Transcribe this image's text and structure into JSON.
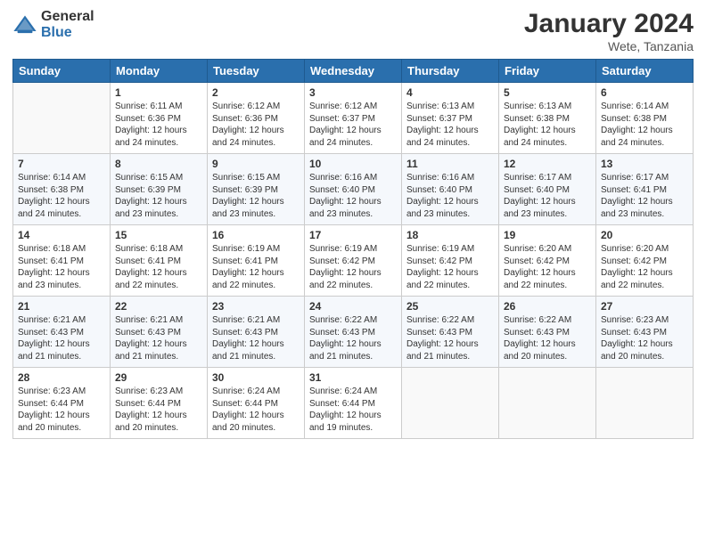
{
  "header": {
    "logo_general": "General",
    "logo_blue": "Blue",
    "month_year": "January 2024",
    "location": "Wete, Tanzania"
  },
  "columns": [
    "Sunday",
    "Monday",
    "Tuesday",
    "Wednesday",
    "Thursday",
    "Friday",
    "Saturday"
  ],
  "weeks": [
    [
      {
        "day": "",
        "sunrise": "",
        "sunset": "",
        "daylight": ""
      },
      {
        "day": "1",
        "sunrise": "Sunrise: 6:11 AM",
        "sunset": "Sunset: 6:36 PM",
        "daylight": "Daylight: 12 hours and 24 minutes."
      },
      {
        "day": "2",
        "sunrise": "Sunrise: 6:12 AM",
        "sunset": "Sunset: 6:36 PM",
        "daylight": "Daylight: 12 hours and 24 minutes."
      },
      {
        "day": "3",
        "sunrise": "Sunrise: 6:12 AM",
        "sunset": "Sunset: 6:37 PM",
        "daylight": "Daylight: 12 hours and 24 minutes."
      },
      {
        "day": "4",
        "sunrise": "Sunrise: 6:13 AM",
        "sunset": "Sunset: 6:37 PM",
        "daylight": "Daylight: 12 hours and 24 minutes."
      },
      {
        "day": "5",
        "sunrise": "Sunrise: 6:13 AM",
        "sunset": "Sunset: 6:38 PM",
        "daylight": "Daylight: 12 hours and 24 minutes."
      },
      {
        "day": "6",
        "sunrise": "Sunrise: 6:14 AM",
        "sunset": "Sunset: 6:38 PM",
        "daylight": "Daylight: 12 hours and 24 minutes."
      }
    ],
    [
      {
        "day": "7",
        "sunrise": "Sunrise: 6:14 AM",
        "sunset": "Sunset: 6:38 PM",
        "daylight": "Daylight: 12 hours and 24 minutes."
      },
      {
        "day": "8",
        "sunrise": "Sunrise: 6:15 AM",
        "sunset": "Sunset: 6:39 PM",
        "daylight": "Daylight: 12 hours and 23 minutes."
      },
      {
        "day": "9",
        "sunrise": "Sunrise: 6:15 AM",
        "sunset": "Sunset: 6:39 PM",
        "daylight": "Daylight: 12 hours and 23 minutes."
      },
      {
        "day": "10",
        "sunrise": "Sunrise: 6:16 AM",
        "sunset": "Sunset: 6:40 PM",
        "daylight": "Daylight: 12 hours and 23 minutes."
      },
      {
        "day": "11",
        "sunrise": "Sunrise: 6:16 AM",
        "sunset": "Sunset: 6:40 PM",
        "daylight": "Daylight: 12 hours and 23 minutes."
      },
      {
        "day": "12",
        "sunrise": "Sunrise: 6:17 AM",
        "sunset": "Sunset: 6:40 PM",
        "daylight": "Daylight: 12 hours and 23 minutes."
      },
      {
        "day": "13",
        "sunrise": "Sunrise: 6:17 AM",
        "sunset": "Sunset: 6:41 PM",
        "daylight": "Daylight: 12 hours and 23 minutes."
      }
    ],
    [
      {
        "day": "14",
        "sunrise": "Sunrise: 6:18 AM",
        "sunset": "Sunset: 6:41 PM",
        "daylight": "Daylight: 12 hours and 23 minutes."
      },
      {
        "day": "15",
        "sunrise": "Sunrise: 6:18 AM",
        "sunset": "Sunset: 6:41 PM",
        "daylight": "Daylight: 12 hours and 22 minutes."
      },
      {
        "day": "16",
        "sunrise": "Sunrise: 6:19 AM",
        "sunset": "Sunset: 6:41 PM",
        "daylight": "Daylight: 12 hours and 22 minutes."
      },
      {
        "day": "17",
        "sunrise": "Sunrise: 6:19 AM",
        "sunset": "Sunset: 6:42 PM",
        "daylight": "Daylight: 12 hours and 22 minutes."
      },
      {
        "day": "18",
        "sunrise": "Sunrise: 6:19 AM",
        "sunset": "Sunset: 6:42 PM",
        "daylight": "Daylight: 12 hours and 22 minutes."
      },
      {
        "day": "19",
        "sunrise": "Sunrise: 6:20 AM",
        "sunset": "Sunset: 6:42 PM",
        "daylight": "Daylight: 12 hours and 22 minutes."
      },
      {
        "day": "20",
        "sunrise": "Sunrise: 6:20 AM",
        "sunset": "Sunset: 6:42 PM",
        "daylight": "Daylight: 12 hours and 22 minutes."
      }
    ],
    [
      {
        "day": "21",
        "sunrise": "Sunrise: 6:21 AM",
        "sunset": "Sunset: 6:43 PM",
        "daylight": "Daylight: 12 hours and 21 minutes."
      },
      {
        "day": "22",
        "sunrise": "Sunrise: 6:21 AM",
        "sunset": "Sunset: 6:43 PM",
        "daylight": "Daylight: 12 hours and 21 minutes."
      },
      {
        "day": "23",
        "sunrise": "Sunrise: 6:21 AM",
        "sunset": "Sunset: 6:43 PM",
        "daylight": "Daylight: 12 hours and 21 minutes."
      },
      {
        "day": "24",
        "sunrise": "Sunrise: 6:22 AM",
        "sunset": "Sunset: 6:43 PM",
        "daylight": "Daylight: 12 hours and 21 minutes."
      },
      {
        "day": "25",
        "sunrise": "Sunrise: 6:22 AM",
        "sunset": "Sunset: 6:43 PM",
        "daylight": "Daylight: 12 hours and 21 minutes."
      },
      {
        "day": "26",
        "sunrise": "Sunrise: 6:22 AM",
        "sunset": "Sunset: 6:43 PM",
        "daylight": "Daylight: 12 hours and 20 minutes."
      },
      {
        "day": "27",
        "sunrise": "Sunrise: 6:23 AM",
        "sunset": "Sunset: 6:43 PM",
        "daylight": "Daylight: 12 hours and 20 minutes."
      }
    ],
    [
      {
        "day": "28",
        "sunrise": "Sunrise: 6:23 AM",
        "sunset": "Sunset: 6:44 PM",
        "daylight": "Daylight: 12 hours and 20 minutes."
      },
      {
        "day": "29",
        "sunrise": "Sunrise: 6:23 AM",
        "sunset": "Sunset: 6:44 PM",
        "daylight": "Daylight: 12 hours and 20 minutes."
      },
      {
        "day": "30",
        "sunrise": "Sunrise: 6:24 AM",
        "sunset": "Sunset: 6:44 PM",
        "daylight": "Daylight: 12 hours and 20 minutes."
      },
      {
        "day": "31",
        "sunrise": "Sunrise: 6:24 AM",
        "sunset": "Sunset: 6:44 PM",
        "daylight": "Daylight: 12 hours and 19 minutes."
      },
      {
        "day": "",
        "sunrise": "",
        "sunset": "",
        "daylight": ""
      },
      {
        "day": "",
        "sunrise": "",
        "sunset": "",
        "daylight": ""
      },
      {
        "day": "",
        "sunrise": "",
        "sunset": "",
        "daylight": ""
      }
    ]
  ]
}
